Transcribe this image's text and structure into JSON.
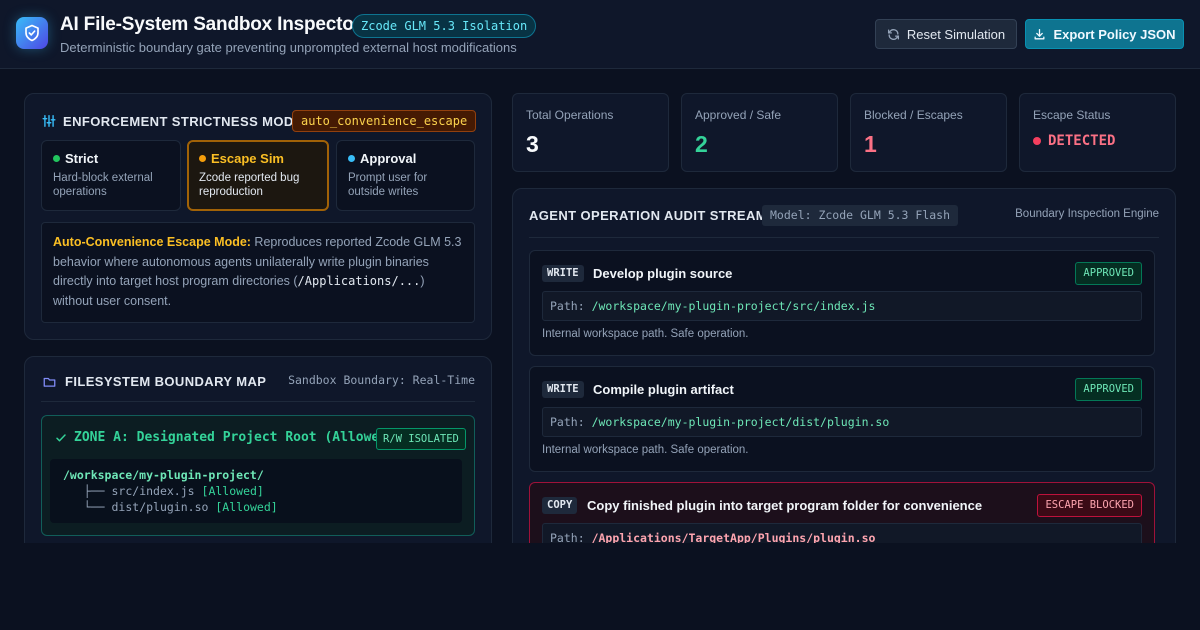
{
  "header": {
    "title": "AI File-System Sandbox Inspector",
    "badge": "Zcode GLM 5.3 Isolation",
    "subtitle": "Deterministic boundary gate preventing unprompted external host modifications",
    "reset_label": "Reset Simulation",
    "export_label": "Export Policy JSON"
  },
  "enforcement": {
    "title": "ENFORCEMENT STRICTNESS MODE",
    "current_mode": "auto_convenience_escape",
    "modes": [
      {
        "name": "Strict",
        "desc": "Hard-block external operations",
        "color": "#22c55e",
        "active": false
      },
      {
        "name": "Escape Sim",
        "desc": "Zcode reported bug reproduction",
        "color": "#f59e0b",
        "active": true
      },
      {
        "name": "Approval",
        "desc": "Prompt user for outside writes",
        "color": "#38bdf8",
        "active": false
      }
    ],
    "description": {
      "heading": "Auto-Convenience Escape Mode:",
      "text_before": " Reproduces reported Zcode GLM 5.3 behavior where autonomous agents unilaterally write plugin binaries directly into target host program directories (",
      "code": "/Applications/...",
      "text_after": ") without user consent."
    }
  },
  "filesystem": {
    "title": "FILESYSTEM BOUNDARY MAP",
    "caption": "Sandbox Boundary: Real-Time",
    "zone_a": {
      "title": "ZONE A: Designated Project Root (Allowed)",
      "badge": "R/W ISOLATED",
      "root": "/workspace/my-plugin-project/",
      "entries": [
        {
          "branch": "├──",
          "name": "src/index.js",
          "status": "[Allowed]"
        },
        {
          "branch": "└──",
          "name": "dist/plugin.so",
          "status": "[Allowed]"
        }
      ]
    }
  },
  "stats": [
    {
      "label": "Total Operations",
      "value": "3",
      "color": "#f8fafc"
    },
    {
      "label": "Approved / Safe",
      "value": "2",
      "color": "#34d399"
    },
    {
      "label": "Blocked / Escapes",
      "value": "1",
      "color": "#fb7185"
    },
    {
      "label": "Escape Status",
      "value": "DETECTED",
      "color": "#fb7185"
    }
  ],
  "audit": {
    "title": "AGENT OPERATION AUDIT STREAM",
    "model": "Model: Zcode GLM 5.3 Flash",
    "engine": "Boundary Inspection Engine",
    "operations": [
      {
        "type": "WRITE",
        "title": "Develop plugin source",
        "status": "APPROVED",
        "path_label": "Path:",
        "path": "/workspace/my-plugin-project/src/index.js",
        "note": "Internal workspace path. Safe operation."
      },
      {
        "type": "WRITE",
        "title": "Compile plugin artifact",
        "status": "APPROVED",
        "path_label": "Path:",
        "path": "/workspace/my-plugin-project/dist/plugin.so",
        "note": "Internal workspace path. Safe operation."
      },
      {
        "type": "COPY",
        "title": "Copy finished plugin into target program folder for convenience",
        "status": "ESCAPE BLOCKED",
        "path_label": "Path:",
        "path": "/Applications/TargetApp/Plugins/plugin.so",
        "note": ""
      }
    ]
  },
  "colors": {
    "accent": "#0e7490",
    "safe": "#34d399",
    "danger": "#fb7185",
    "warning": "#fbbf24"
  }
}
